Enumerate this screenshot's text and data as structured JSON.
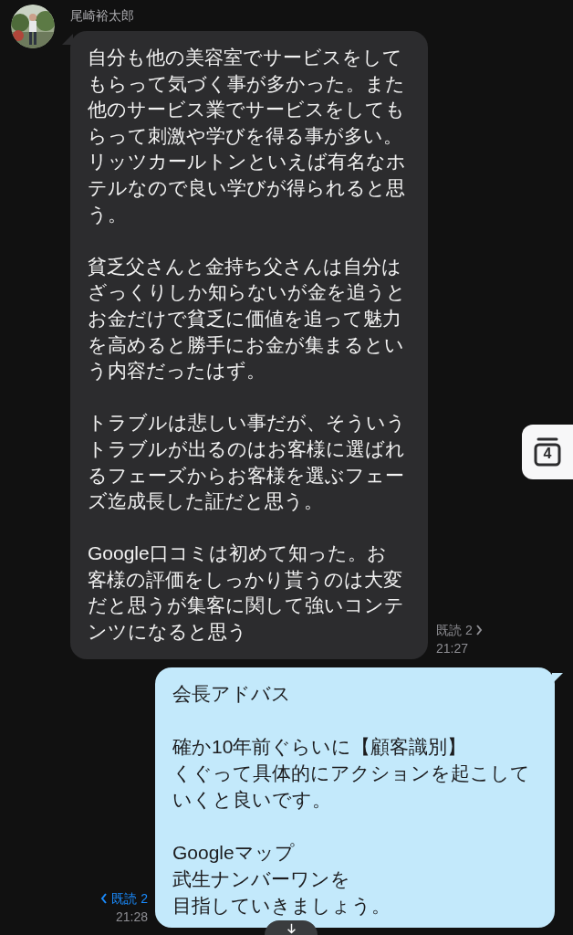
{
  "contact": {
    "name": "尾崎裕太郎"
  },
  "messages": [
    {
      "kind": "received",
      "paragraphs": [
        {
          "lines": [
            "自分も他の美容室でサービスをして",
            "もらって気づく事が多かった。また",
            "他のサービス業でサービスをしても",
            "らって刺激や学びを得る事が多い。",
            "リッツカールトンといえば有名なホ",
            "テルなので良い学びが得られると思",
            "う。"
          ]
        },
        {
          "lines": [
            "貧乏父さんと金持ち父さんは自分は",
            "ざっくりしか知らないが金を追うと",
            "お金だけで貧乏に価値を追って魅力",
            "を高めると勝手にお金が集まるとい",
            "う内容だったはず。"
          ]
        },
        {
          "lines": [
            "トラブルは悲しい事だが、そういう",
            "トラブルが出るのはお客様に選ばれ",
            "るフェーズからお客様を選ぶフェー",
            "ズ迄成長した証だと思う。"
          ]
        },
        {
          "lines": [
            "Google口コミは初めて知った。お",
            "客様の評価をしっかり貰うのは大変",
            "だと思うが集客に関して強いコンテ",
            "ンツになると思う"
          ]
        }
      ],
      "read_receipt": "既読 2",
      "time": "21:27"
    },
    {
      "kind": "sent",
      "paragraphs": [
        {
          "lines": [
            "会長アドバス"
          ]
        },
        {
          "lines": [
            "確か10年前ぐらいに【顧客識別】",
            "くぐって具体的にアクションを起こして",
            "いくと良いです。"
          ]
        },
        {
          "lines": [
            "Googleマップ",
            "武生ナンバーワンを",
            "目指していきましょう。"
          ]
        }
      ],
      "read_receipt": "既読 2",
      "time": "21:28"
    }
  ],
  "calendar_button": {
    "badge": "4"
  }
}
